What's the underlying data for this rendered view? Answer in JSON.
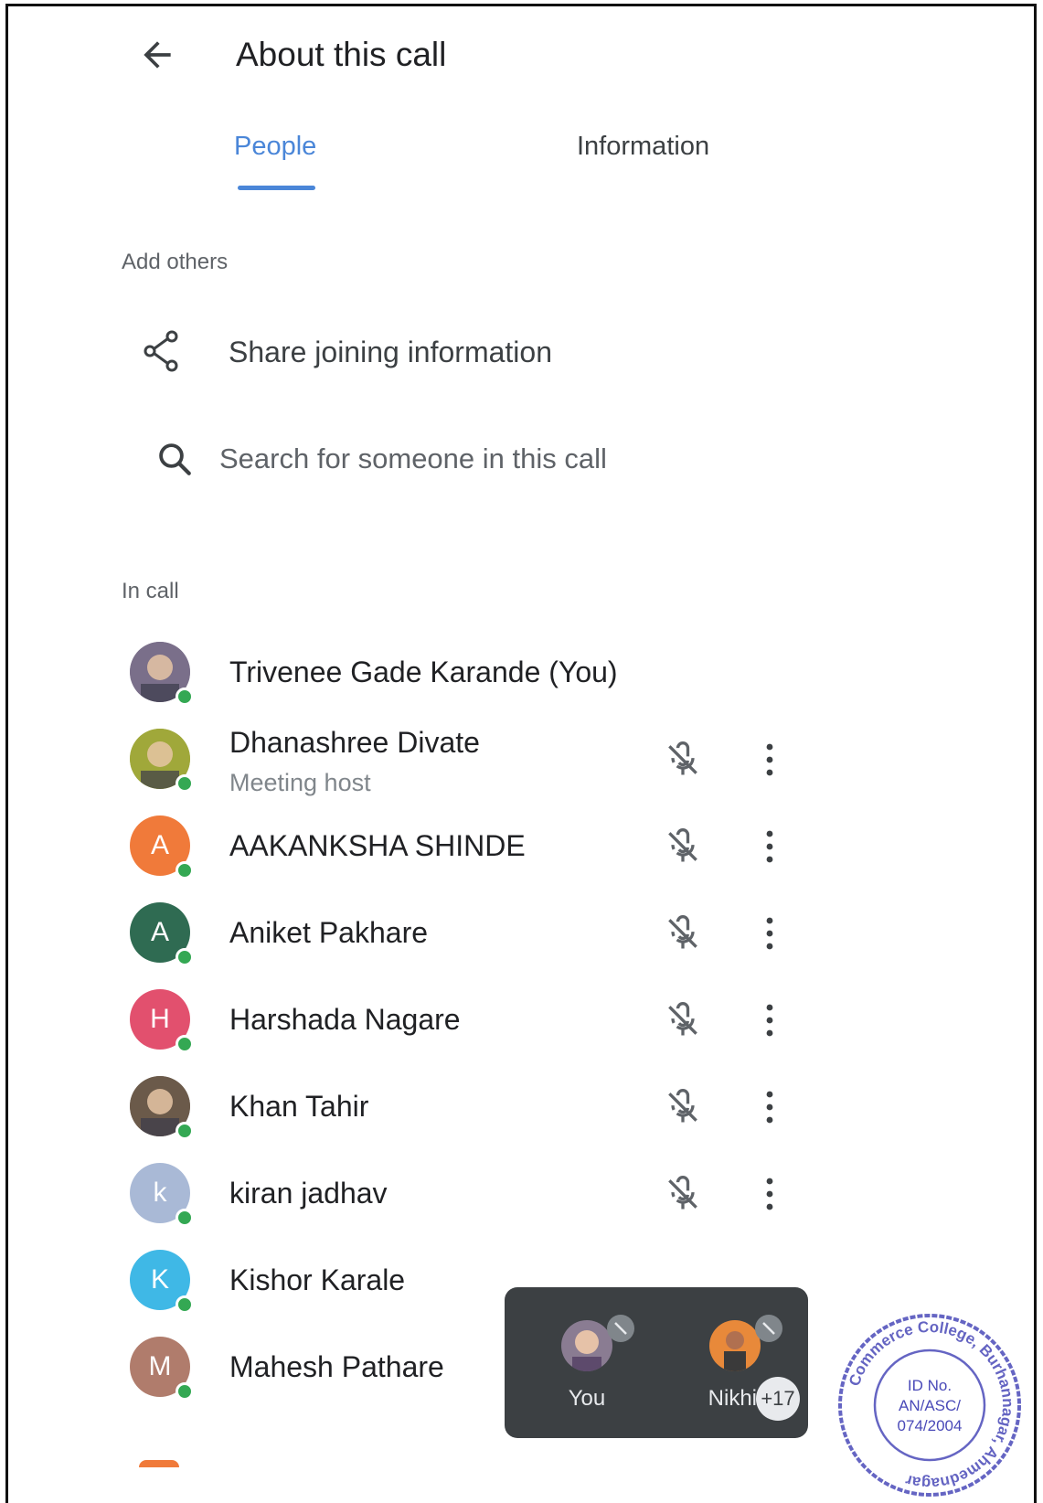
{
  "header": {
    "title": "About this call"
  },
  "tabs": [
    {
      "label": "People",
      "active": true
    },
    {
      "label": "Information",
      "active": false
    }
  ],
  "add_others": {
    "section_label": "Add others",
    "share_label": "Share joining information",
    "search_placeholder": "Search for someone in this call"
  },
  "in_call": {
    "section_label": "In call",
    "participants": [
      {
        "name": "Trivenee Gade Karande (You)",
        "role": "",
        "initial": "",
        "avatar_color": "#7a6f8a",
        "photo": true,
        "controls": false
      },
      {
        "name": "Dhanashree Divate",
        "role": "Meeting host",
        "initial": "",
        "avatar_color": "#a0a83a",
        "photo": true,
        "controls": true
      },
      {
        "name": "AAKANKSHA SHINDE",
        "role": "",
        "initial": "A",
        "avatar_color": "#f07a3a",
        "photo": false,
        "controls": true
      },
      {
        "name": "Aniket Pakhare",
        "role": "",
        "initial": "A",
        "avatar_color": "#2f6b52",
        "photo": false,
        "controls": true
      },
      {
        "name": "Harshada Nagare",
        "role": "",
        "initial": "H",
        "avatar_color": "#e2506e",
        "photo": false,
        "controls": true
      },
      {
        "name": "Khan Tahir",
        "role": "",
        "initial": "",
        "avatar_color": "#6b5a4a",
        "photo": true,
        "controls": true
      },
      {
        "name": "kiran jadhav",
        "role": "",
        "initial": "k",
        "avatar_color": "#a9b9d6",
        "photo": false,
        "controls": true
      },
      {
        "name": "Kishor Karale",
        "role": "",
        "initial": "K",
        "avatar_color": "#3fb8e6",
        "photo": false,
        "controls": false
      },
      {
        "name": "Mahesh Pathare",
        "role": "",
        "initial": "M",
        "avatar_color": "#b07c6c",
        "photo": false,
        "controls": false
      }
    ]
  },
  "mini_tiles": {
    "you_label": "You",
    "other_label": "Nikhil",
    "extra_count": "+17"
  },
  "stamp": {
    "line1": "ID No.",
    "line2": "AN/ASC/",
    "line3": "074/2004",
    "ring_text": "Commerce College, Burhannagar, Ahmednagar"
  },
  "colors": {
    "accent": "#4a86d8",
    "online": "#34a853",
    "tile_bg": "#3c4043",
    "stamp": "#4a4ab8"
  }
}
